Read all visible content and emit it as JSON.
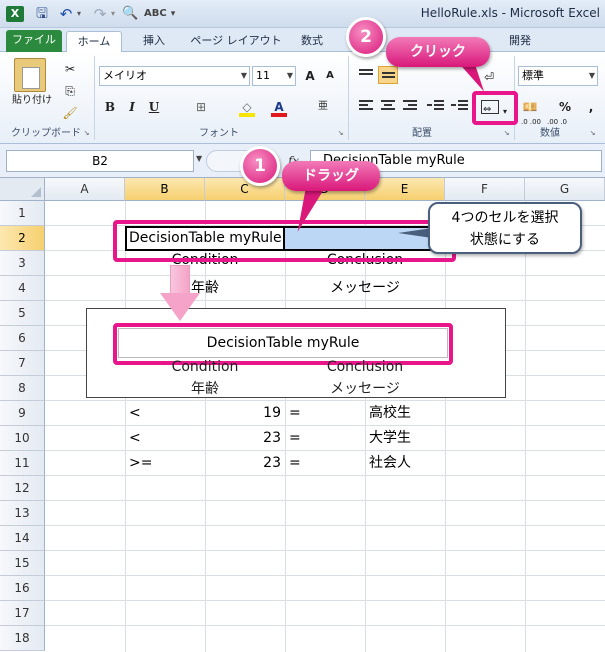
{
  "titlebar": {
    "title": "HelloRule.xls  -  Microsoft Excel",
    "app_logo": "X"
  },
  "tabs": [
    "ファイル",
    "ホーム",
    "挿入",
    "ページ レイアウト",
    "数式",
    "開発"
  ],
  "ribbon": {
    "clipboard": {
      "paste": "貼り付け",
      "label": "クリップボード"
    },
    "font": {
      "name": "メイリオ",
      "size": "11",
      "label": "フォント",
      "grow": "A",
      "shrink": "A",
      "bold": "B",
      "italic": "I",
      "underline": "U",
      "font_color": "A"
    },
    "alignment": {
      "label": "配置"
    },
    "number": {
      "format": "標準",
      "label": "数値",
      "percent": "%",
      "comma": ",",
      "dec_inc": ".0 .00",
      "dec_dec": ".00 .0"
    }
  },
  "formula_bar": {
    "name_box": "B2",
    "fx": "fx",
    "formula": "DecisionTable myRule"
  },
  "grid": {
    "columns": [
      "A",
      "B",
      "C",
      "D",
      "E",
      "F",
      "G"
    ],
    "rows": [
      "1",
      "2",
      "3",
      "4",
      "5",
      "6",
      "7",
      "8",
      "9",
      "10",
      "11",
      "12",
      "13",
      "14",
      "15",
      "16",
      "17",
      "18"
    ],
    "cells": {
      "b2": "DecisionTable myRule",
      "b3": "Condition",
      "d3": "Conclusion",
      "b4": "年齢",
      "d4": "メッセージ",
      "b9": "<",
      "c9": "19",
      "d9": "=",
      "e9": "高校生",
      "b10": "<",
      "c10": "23",
      "d10": "=",
      "e10": "大学生",
      "b11": ">=",
      "c11": "23",
      "d11": "=",
      "e11": "社会人"
    }
  },
  "result_preview": {
    "title": "DecisionTable myRule",
    "condition": "Condition",
    "conclusion": "Conclusion",
    "age": "年齢",
    "message": "メッセージ"
  },
  "annotations": {
    "step1_number": "1",
    "step1_label": "ドラッグ",
    "step2_number": "2",
    "step2_label": "クリック",
    "callout_line1": "4つのセルを選択",
    "callout_line2": "状態にする"
  },
  "colors": {
    "accent_magenta": "#e8168a",
    "excel_green": "#2c8a3e",
    "selection_blue": "#bcd7f5",
    "header_selected": "#f6cf6f"
  }
}
